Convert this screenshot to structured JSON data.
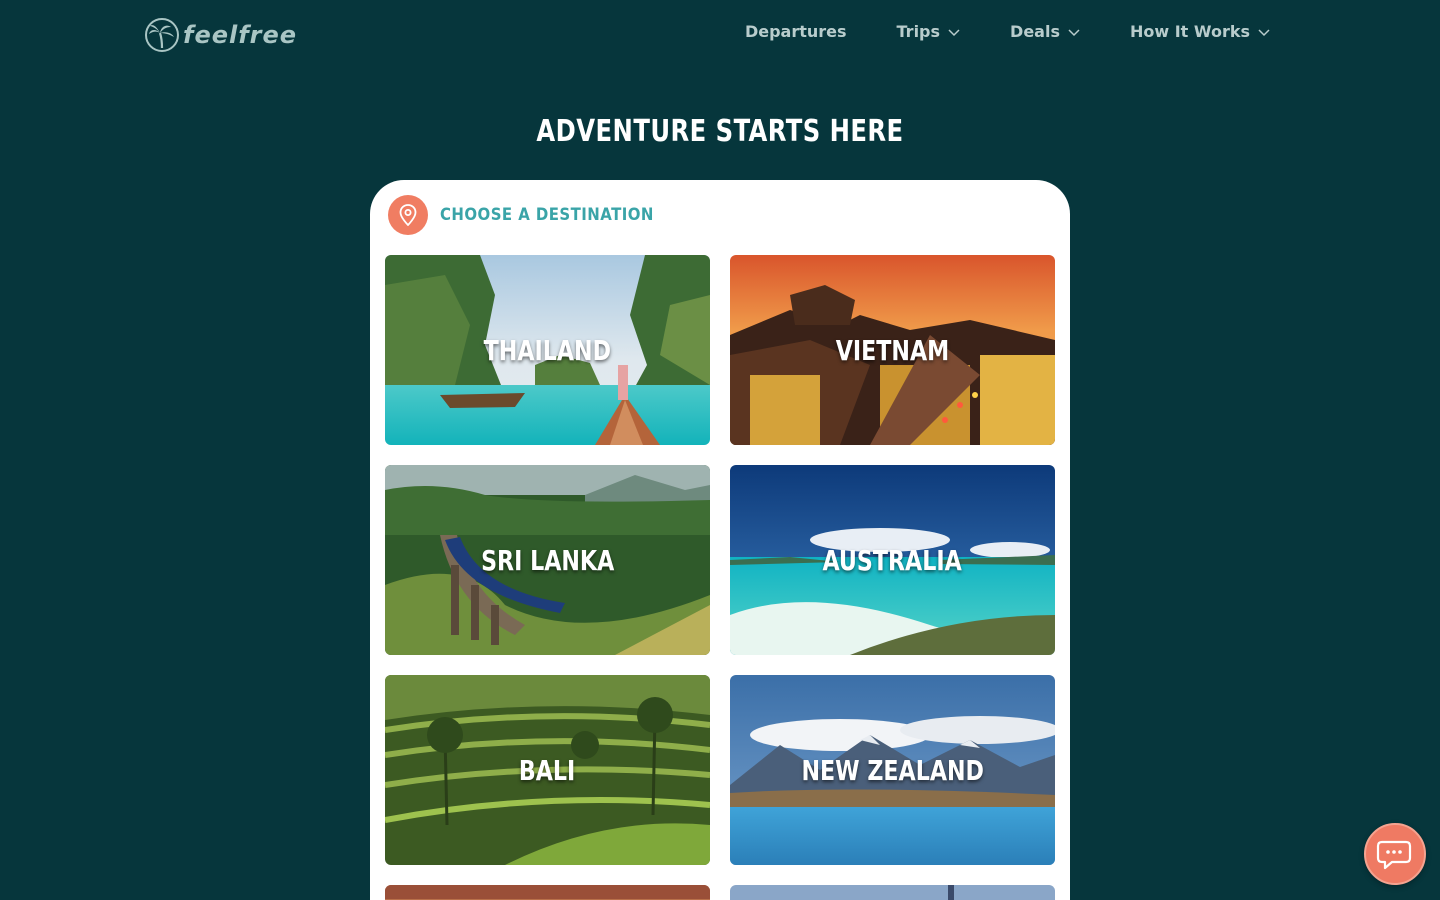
{
  "brand": {
    "name": "feelfree"
  },
  "nav": [
    {
      "label": "Departures",
      "has_dropdown": false
    },
    {
      "label": "Trips",
      "has_dropdown": true
    },
    {
      "label": "Deals",
      "has_dropdown": true
    },
    {
      "label": "How It Works",
      "has_dropdown": true
    }
  ],
  "hero": {
    "title": "ADVENTURE STARTS HERE"
  },
  "destination_panel": {
    "title": "CHOOSE A DESTINATION",
    "icon": "map-pin-icon",
    "destinations": [
      {
        "label": "THAILAND"
      },
      {
        "label": "VIETNAM"
      },
      {
        "label": "SRI LANKA"
      },
      {
        "label": "AUSTRALIA"
      },
      {
        "label": "BALI"
      },
      {
        "label": "NEW ZEALAND"
      }
    ]
  },
  "chat": {
    "icon": "chat-bubble-icon"
  },
  "colors": {
    "background": "#06363c",
    "accent": "#f07d62",
    "teal_text": "#3aa4a8",
    "nav_text": "#b8cccc"
  }
}
